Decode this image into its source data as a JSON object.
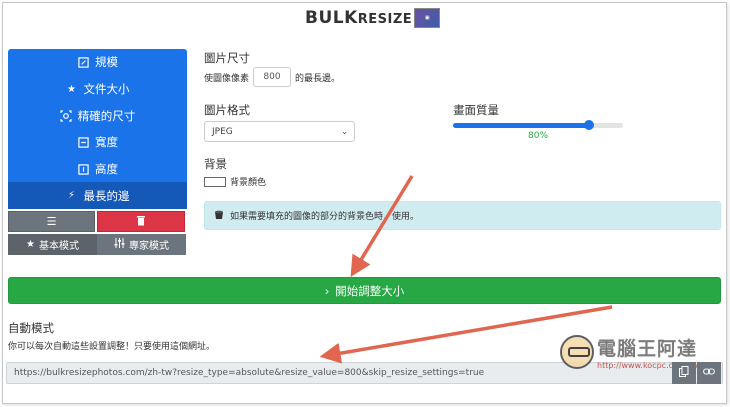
{
  "logo": {
    "text_main": "BULK",
    "text_resize": "RESIZE"
  },
  "sidebar": {
    "items": [
      {
        "label": "規模",
        "icon": "edit-square-icon"
      },
      {
        "label": "文件大小",
        "icon": "star-icon"
      },
      {
        "label": "精確的尺寸",
        "icon": "crosshair-icon"
      },
      {
        "label": "寬度",
        "icon": "width-box-icon"
      },
      {
        "label": "高度",
        "icon": "height-box-icon"
      },
      {
        "label": "最長的邊",
        "icon": "bolt-icon",
        "active": true
      }
    ],
    "list_icon": "list-icon",
    "delete_icon": "trash-icon",
    "basic_mode": "基本模式",
    "expert_mode": "專家模式"
  },
  "image_size": {
    "title": "圖片尺寸",
    "prefix": "使圖像像素",
    "value": "800",
    "suffix": "的最長邊。"
  },
  "image_format": {
    "title": "圖片格式",
    "selected": "JPEG"
  },
  "quality": {
    "title": "畫面質量",
    "value_label": "80%",
    "value": 80
  },
  "background": {
    "title": "背景",
    "color_label": "背景顏色"
  },
  "alert": {
    "text": "如果需要填充的圖像的部分的背景色時，使用。"
  },
  "start_button": {
    "label": "開始調整大小"
  },
  "auto_mode": {
    "title": "自動模式",
    "desc": "你可以每次自動這些設置調整！只要使用這個網址。",
    "url": "https://bulkresizephotos.com/zh-tw?resize_type=absolute&resize_value=800&skip_resize_settings=true"
  },
  "watermark": {
    "text": "電腦王阿達",
    "url": "http://www.kocpc.com.tw"
  },
  "colors": {
    "primary": "#1a73e8",
    "success": "#28a745",
    "danger": "#dc3545",
    "secondary": "#6c757d",
    "info_bg": "#d1ecf1",
    "arrow": "#e06650"
  }
}
